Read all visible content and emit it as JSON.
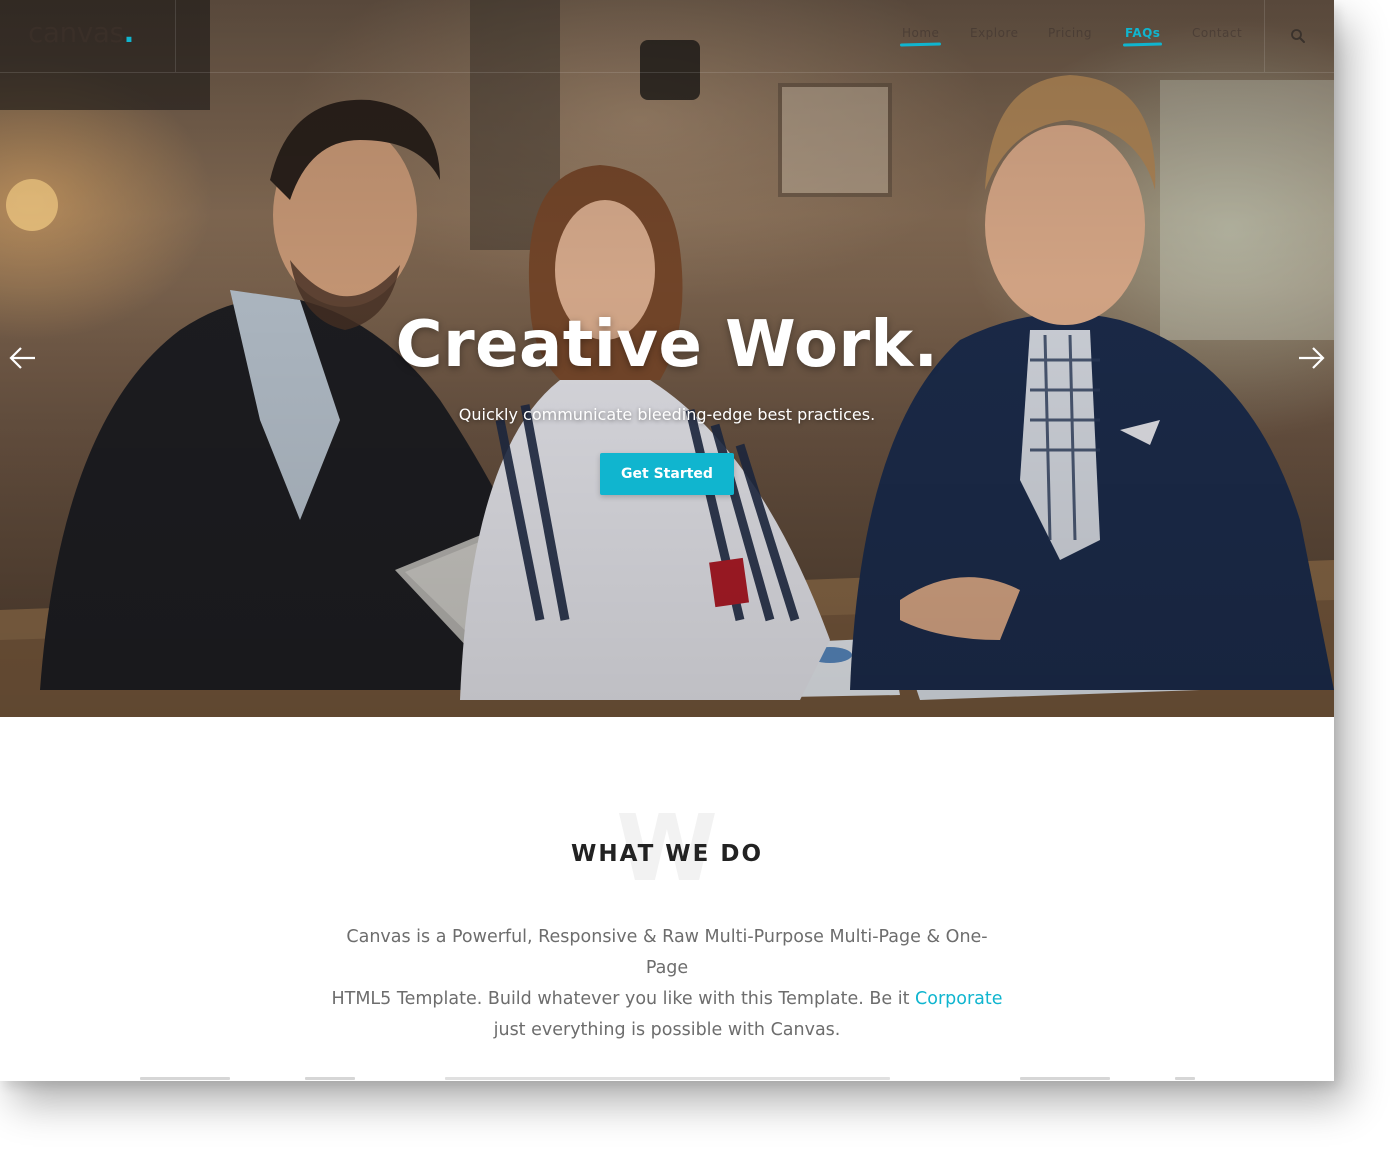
{
  "header": {
    "logo_text": "canvas",
    "logo_dot": ".",
    "nav": [
      {
        "label": "Home",
        "active": false,
        "underlined": true
      },
      {
        "label": "Explore",
        "active": false,
        "underlined": false
      },
      {
        "label": "Pricing",
        "active": false,
        "underlined": false
      },
      {
        "label": "FAQs",
        "active": true,
        "underlined": true
      },
      {
        "label": "Contact",
        "active": false,
        "underlined": false
      }
    ],
    "search_icon": "search-icon"
  },
  "hero": {
    "title": "Creative Work.",
    "subtitle": "Quickly communicate bleeding-edge best practices.",
    "cta_label": "Get Started",
    "prev_icon": "arrow-left-icon",
    "next_icon": "arrow-right-icon"
  },
  "section": {
    "bg_letter": "W",
    "title": "WHAT WE DO",
    "lead_line1": "Canvas is a Powerful, Responsive & Raw Multi-Purpose Multi-Page & One-Page",
    "lead_line2": "HTML5 Template. Build whatever you like with this Template. Be it ",
    "lead_link": "Corporate",
    "lead_line3": "just everything is possible with Canvas."
  },
  "colors": {
    "accent": "#10b5cf",
    "heading": "#222222",
    "body_text": "#6d6d6d"
  }
}
